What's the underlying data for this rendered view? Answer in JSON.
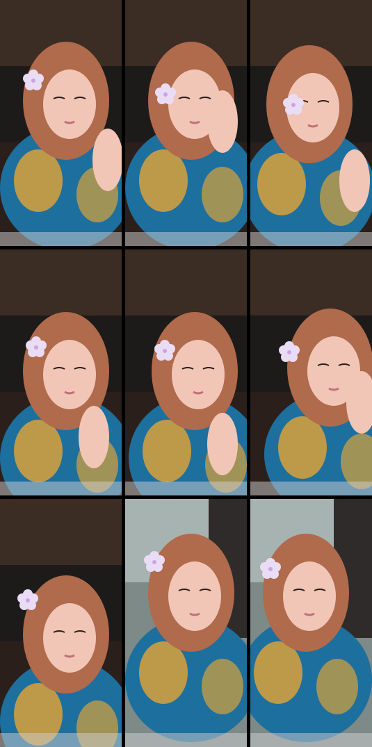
{
  "frames": [
    {
      "id": "frame-1",
      "setting": "dark-room",
      "pose": "hand-raised"
    },
    {
      "id": "frame-2",
      "setting": "dark-room",
      "pose": "hand-on-cheek"
    },
    {
      "id": "frame-3",
      "setting": "dark-room",
      "pose": "head-tilt"
    },
    {
      "id": "frame-4",
      "setting": "dark-room",
      "pose": "finger-to-chin"
    },
    {
      "id": "frame-5",
      "setting": "dark-room",
      "pose": "hand-on-chin"
    },
    {
      "id": "frame-6",
      "setting": "dark-room",
      "pose": "resting-on-hand"
    },
    {
      "id": "frame-7",
      "setting": "dark-room",
      "pose": "looking-down"
    },
    {
      "id": "frame-8",
      "setting": "bright-room",
      "pose": "smiling"
    },
    {
      "id": "frame-9",
      "setting": "bright-room",
      "pose": "neutral"
    }
  ],
  "colors": {
    "background": "#000000",
    "hair": "#b06a4c",
    "skin": "#f1c6b6",
    "shirt_blue": "#1d6f9e",
    "shirt_yellow": "#d8a23a",
    "flower": "#e9dcf4"
  }
}
